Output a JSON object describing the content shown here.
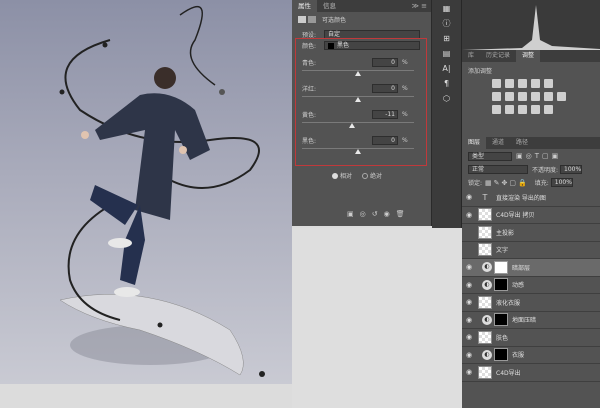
{
  "properties": {
    "tabs": [
      "属性",
      "信息"
    ],
    "title": "可选颜色",
    "preset_label": "预设:",
    "preset_value": "自定",
    "color_label": "颜色:",
    "color_value": "黑色",
    "sliders": [
      {
        "label": "青色:",
        "value": "0",
        "unit": "%",
        "pos": 0.5
      },
      {
        "label": "洋红:",
        "value": "0",
        "unit": "%",
        "pos": 0.5
      },
      {
        "label": "黄色:",
        "value": "-11",
        "unit": "%",
        "pos": 0.45
      },
      {
        "label": "黑色:",
        "value": "0",
        "unit": "%",
        "pos": 0.5
      }
    ],
    "mode_relative": "相对",
    "mode_absolute": "绝对"
  },
  "right_panel": {
    "lib_tabs": [
      "库",
      "历史记录",
      "调整"
    ],
    "adjust_title": "添加调整",
    "layer_tabs": [
      "图层",
      "通道",
      "路径"
    ],
    "kind_filter": "类型",
    "blend_mode": "正常",
    "opacity_label": "不透明度:",
    "opacity_value": "100%",
    "lock_label": "锁定:",
    "fill_label": "填充:",
    "fill_value": "100%",
    "layers": [
      {
        "name": "直接渲染 导出的图",
        "type": "text"
      },
      {
        "name": "C4D导出 拷贝",
        "type": "image"
      },
      {
        "name": "主投影",
        "type": "image"
      },
      {
        "name": "文字",
        "type": "image"
      },
      {
        "name": "暗部层",
        "type": "adjust",
        "selected": true
      },
      {
        "name": "动感",
        "type": "adjust"
      },
      {
        "name": "液化衣服",
        "type": "image"
      },
      {
        "name": "地面压暗",
        "type": "adjust"
      },
      {
        "name": "肤色",
        "type": "image"
      },
      {
        "name": "衣服",
        "type": "adjust"
      },
      {
        "name": "C4D导出",
        "type": "image"
      }
    ]
  },
  "colors": {
    "panel_bg": "#535353",
    "highlight_box": "#c0393b"
  }
}
